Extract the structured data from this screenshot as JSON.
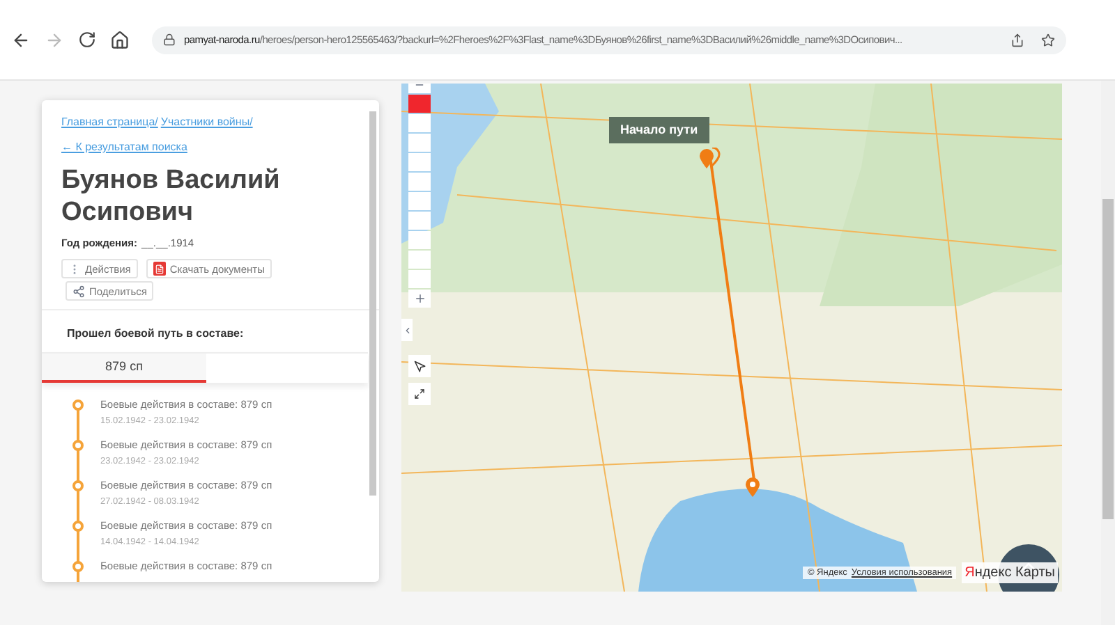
{
  "browser": {
    "url_host": "pamyat-naroda.ru",
    "url_path": "/heroes/person-hero125565463/?backurl=%2Fheroes%2F%3Flast_name%3DБуянов%26first_name%3DВасилий%26middle_name%3DОсипович...",
    "forward_disabled": true
  },
  "breadcrumbs": [
    "Главная страница/",
    "Участники войны/"
  ],
  "back_link": "← К результатам поиска",
  "person": {
    "name": "Буянов Василий Осипович",
    "birth_label": "Год рождения:",
    "birth_value": "__.__.1914"
  },
  "actions": [
    {
      "kind": "menu",
      "label": "Действия"
    },
    {
      "kind": "pdf",
      "label": "Скачать документы"
    },
    {
      "kind": "share",
      "label": "Поделиться"
    }
  ],
  "units_heading": "Прошел боевой путь в составе:",
  "unit_tabs": [
    {
      "label": "879 сп",
      "selected": true
    }
  ],
  "timeline": [
    {
      "title": "Боевые действия в составе: 879 сп",
      "dates": "15.02.1942 - 23.02.1942"
    },
    {
      "title": "Боевые действия в составе: 879 сп",
      "dates": "23.02.1942 - 23.02.1942"
    },
    {
      "title": "Боевые действия в составе: 879 сп",
      "dates": "27.02.1942 - 08.03.1942"
    },
    {
      "title": "Боевые действия в составе: 879 сп",
      "dates": "14.04.1942 - 14.04.1942"
    },
    {
      "title": "Боевые действия в составе: 879 сп"
    }
  ],
  "map": {
    "start_label": "Начало пути",
    "zoom_scale": [
      {
        "selected": true
      },
      {
        "selected": false
      },
      {
        "selected": false
      },
      {
        "selected": false
      },
      {
        "selected": false
      },
      {
        "selected": false
      },
      {
        "selected": false
      },
      {
        "selected": false
      },
      {
        "selected": false
      },
      {
        "selected": false
      }
    ],
    "attribution": "© Яндекс",
    "terms_link": "Условия использования",
    "logo_first": "Я",
    "logo_rest": "ндекс Карты"
  }
}
